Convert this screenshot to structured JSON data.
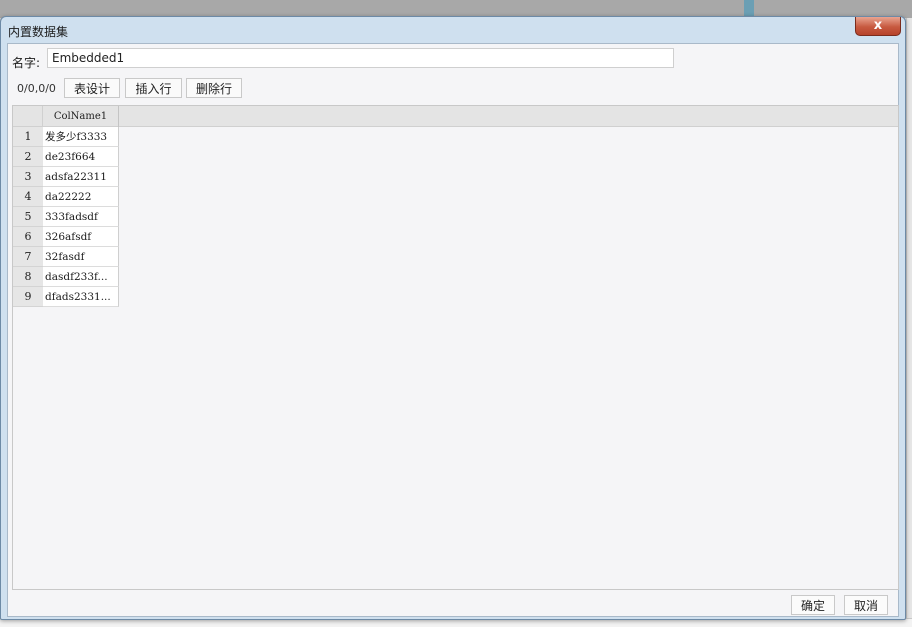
{
  "dialog": {
    "title": "内置数据集",
    "close_label": "x"
  },
  "form": {
    "name_label": "名字:",
    "name_value": "Embedded1"
  },
  "toolbar": {
    "status": "0/0,0/0",
    "table_design_label": "表设计",
    "insert_row_label": "插入行",
    "delete_row_label": "删除行"
  },
  "grid": {
    "columns": [
      "ColName1"
    ],
    "rows": [
      {
        "num": "1",
        "value": "发多少f3333"
      },
      {
        "num": "2",
        "value": "de23f664"
      },
      {
        "num": "3",
        "value": "adsfa22311"
      },
      {
        "num": "4",
        "value": "da22222"
      },
      {
        "num": "5",
        "value": "333fadsdf"
      },
      {
        "num": "6",
        "value": "326afsdf"
      },
      {
        "num": "7",
        "value": "32fasdf"
      },
      {
        "num": "8",
        "value": "dasdf233f..."
      },
      {
        "num": "9",
        "value": "dfads2331..."
      }
    ]
  },
  "footer": {
    "ok_label": "确定",
    "cancel_label": "取消"
  },
  "colors": {
    "close_button": "#c75a40",
    "grid_header": "#e4e4e4",
    "client_background": "#f5f5f7"
  }
}
